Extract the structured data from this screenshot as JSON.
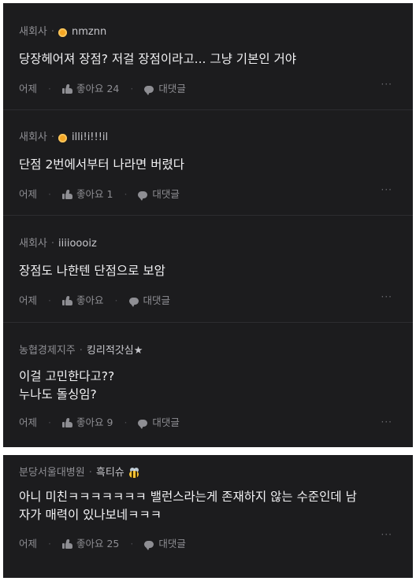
{
  "comments": [
    {
      "company": "새회사",
      "nickname": "nmznn",
      "badge": "coin-icon",
      "lines": [
        "당장헤어져 장점? 저걸 장점이라고... 그냥 기본인 거야"
      ],
      "time": "어제",
      "like_label": "좋아요 24",
      "reply_label": "대댓글",
      "more": "···"
    },
    {
      "company": "새회사",
      "nickname": "illi!i!!!il",
      "badge": "coin-icon",
      "lines": [
        "단점 2번에서부터 나라면 버렸다"
      ],
      "time": "어제",
      "like_label": "좋아요 1",
      "reply_label": "대댓글",
      "more": "···"
    },
    {
      "company": "새회사",
      "nickname": "iiiioooiz",
      "badge": "",
      "lines": [
        "장점도 나한텐 단점으로 보암"
      ],
      "time": "어제",
      "like_label": "좋아요",
      "reply_label": "대댓글",
      "more": "···"
    },
    {
      "company": "농협경제지주",
      "nickname": "킹리적갓심★",
      "badge": "",
      "lines": [
        "이걸 고민한다고??",
        "누나도 돌싱임?"
      ],
      "time": "어제",
      "like_label": "좋아요 9",
      "reply_label": "대댓글",
      "more": "···"
    },
    {
      "company": "분당서울대병원",
      "nickname": "흑티슈",
      "badge": "bee-icon",
      "lines": [
        "아니 미친ㅋㅋㅋㅋㅋㅋㅋ 밸런스라는게 존재하지 않는 수준인데 남",
        "자가 매력이 있나보네ㅋㅋㅋ"
      ],
      "time": "어제",
      "like_label": "좋아요 25",
      "reply_label": "대댓글",
      "more": "···"
    }
  ],
  "separator": "·",
  "colors": {
    "panel_bg": "#1c1c1e",
    "divider": "#2d2d30",
    "muted_text": "#8e8e93",
    "coin_badge": "#f5a623"
  }
}
